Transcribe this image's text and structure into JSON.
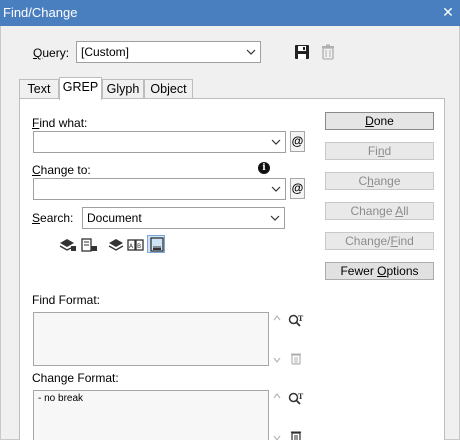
{
  "window": {
    "title": "Find/Change",
    "close_glyph": "✕"
  },
  "query": {
    "label_key": "Q",
    "label_rest": "uery:",
    "value": "[Custom]"
  },
  "tabs": [
    {
      "label": "Text"
    },
    {
      "label": "GREP"
    },
    {
      "label": "Glyph"
    },
    {
      "label": "Object"
    }
  ],
  "find_what": {
    "label_key": "F",
    "label_rest": "ind what:",
    "value": ""
  },
  "change_to": {
    "label_key": "C",
    "label_rest": "hange to:",
    "value": ""
  },
  "search": {
    "label_key": "S",
    "label_rest": "earch:",
    "value": "Document"
  },
  "find_format": {
    "label": "Find Format:",
    "value": ""
  },
  "change_format": {
    "label": "Change Format:",
    "value": "- no break"
  },
  "buttons": {
    "done_key": "D",
    "done_rest": "one",
    "find_pre": "Fi",
    "find_key": "n",
    "find_rest": "d",
    "change_pre": "C",
    "change_key": "h",
    "change_rest": "ange",
    "change_all_pre": "Change ",
    "change_all_key": "A",
    "change_all_rest": "ll",
    "change_find_pre": "Change/",
    "change_find_key": "F",
    "change_find_rest": "ind",
    "fewer_pre": "Fewer ",
    "fewer_key": "O",
    "fewer_rest": "ptions"
  },
  "special_char_glyph": "@",
  "info_glyph": "i",
  "colors": {
    "titlebar": "#4a7fbf",
    "panel": "#ffffff",
    "chrome": "#f0f0f0"
  }
}
